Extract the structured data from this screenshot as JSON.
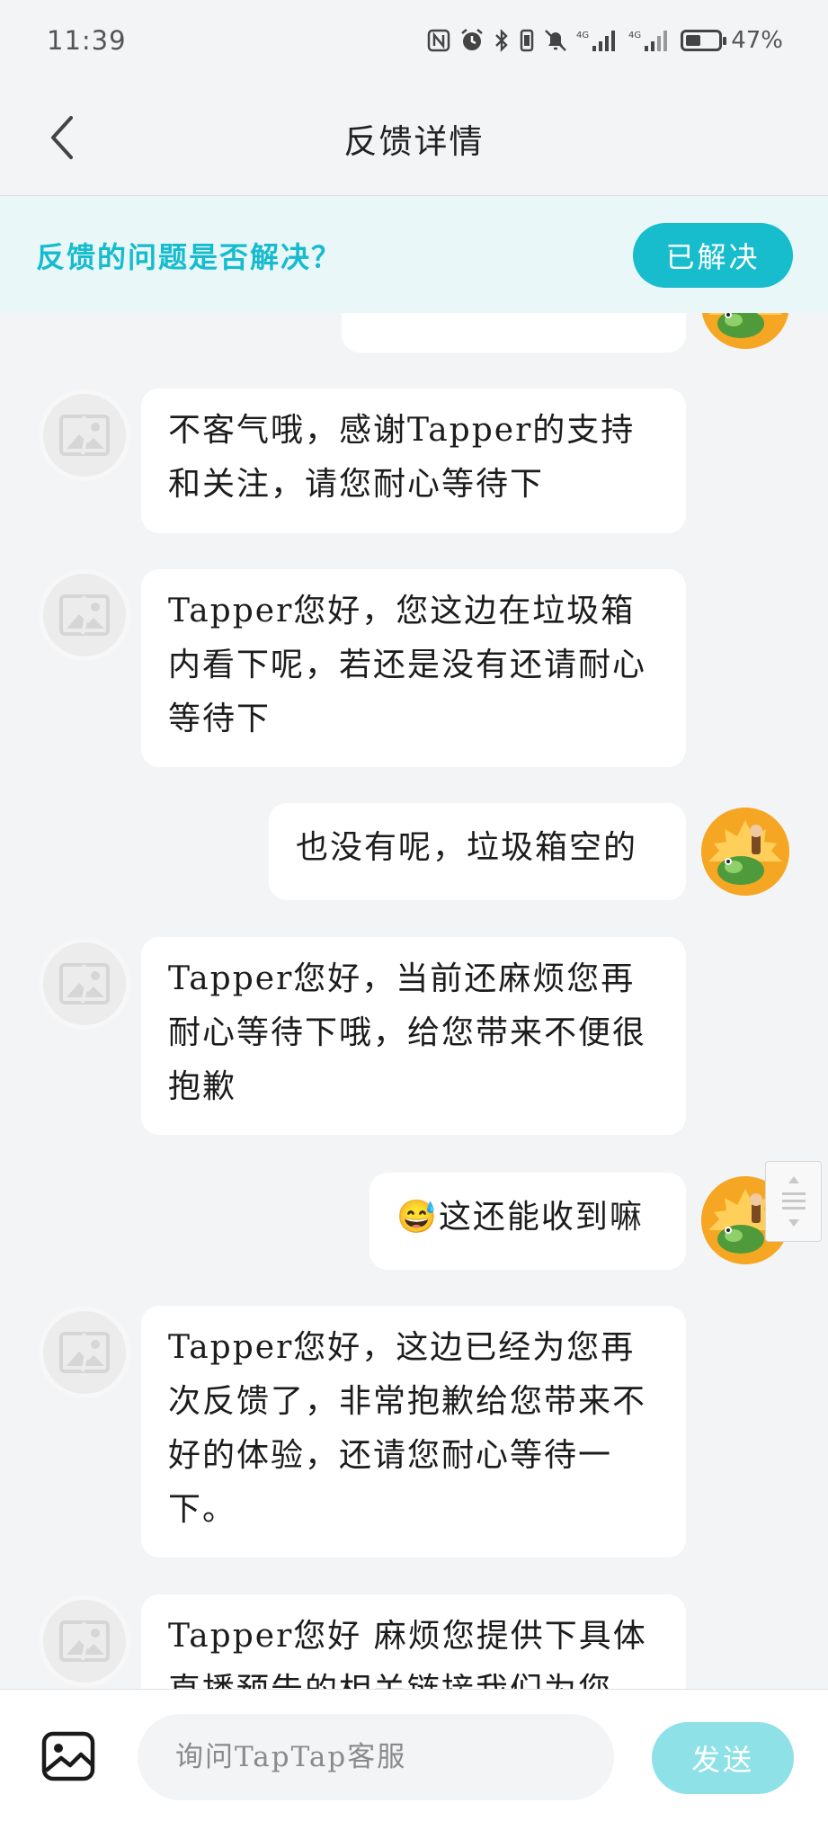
{
  "status_bar": {
    "time": "11:39",
    "battery_pct": "47%",
    "battery_level": 0.47,
    "icons": [
      "nfc-icon",
      "alarm-icon",
      "bluetooth-icon",
      "vibrate-icon",
      "mute-icon",
      "signal-4g-icon",
      "signal-4g-icon"
    ]
  },
  "nav": {
    "title": "反馈详情",
    "back_icon": "chevron-left-icon"
  },
  "banner": {
    "question": "反馈的问题是否解决？",
    "resolved_label": "已解决",
    "accent": "#17bccd"
  },
  "messages": [
    {
      "from": "user",
      "text": ""
    },
    {
      "from": "support",
      "text": "不客气哦，感谢Tapper的支持和关注，请您耐心等待下"
    },
    {
      "from": "support",
      "text": "Tapper您好，您这边在垃圾箱内看下呢，若还是没有还请耐心等待下"
    },
    {
      "from": "user",
      "text": "也没有呢，垃圾箱空的"
    },
    {
      "from": "support",
      "text": "Tapper您好，当前还麻烦您再耐心等待下哦，给您带来不便很抱歉"
    },
    {
      "from": "user",
      "text": "😅这还能收到嘛"
    },
    {
      "from": "support",
      "text": "Tapper您好，这边已经为您再次反馈了，非常抱歉给您带来不好的体验，还请您耐心等待一下。"
    },
    {
      "from": "support",
      "text": "Tapper您好 麻烦您提供下具体直播预告的相关链接我们为您"
    }
  ],
  "input": {
    "placeholder": "询问TapTap客服",
    "value": "",
    "send_label": "发送",
    "image_icon": "image-icon"
  },
  "colors": {
    "background": "#f3f4f6",
    "bubble": "#ffffff",
    "send_disabled": "#8fe1e8"
  }
}
